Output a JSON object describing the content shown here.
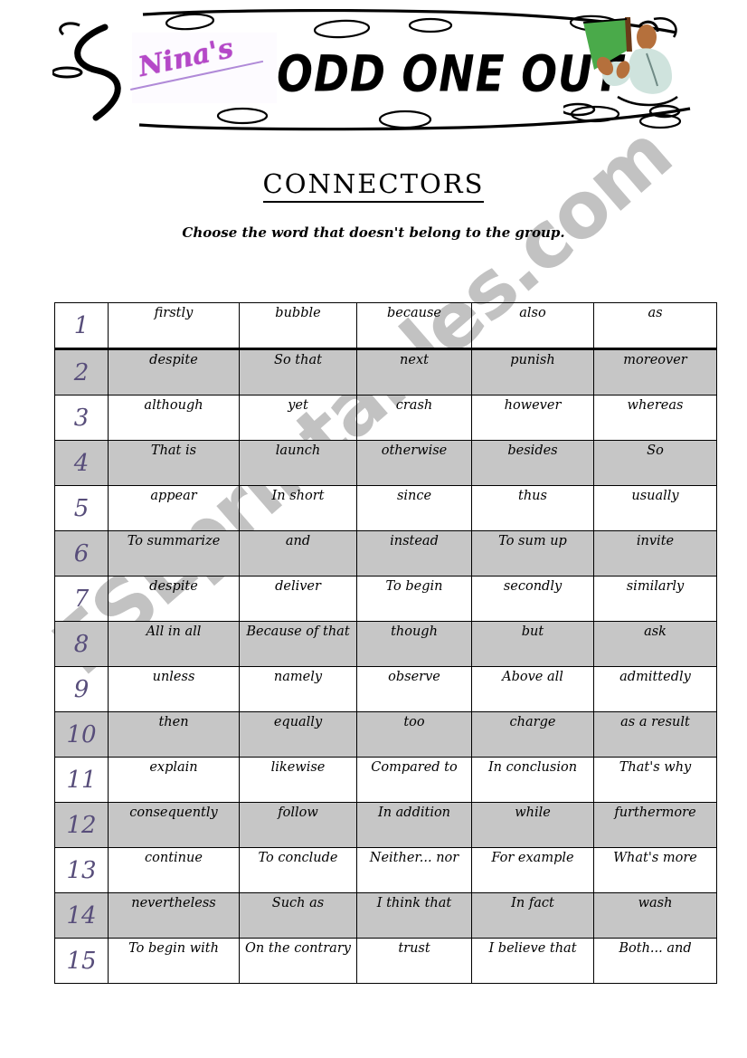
{
  "banner": {
    "brand_label": "Nina's",
    "worksheet_type": "ODD ONE OUT",
    "clipart_name": "person-reading-book-clipart"
  },
  "title": "CONNECTORS",
  "instruction": "Choose the word that doesn't belong to the group.",
  "watermark": "ESLprintables.com",
  "colors": {
    "number_purple": "#574d7a",
    "brand_purple": "#b548c8",
    "row_shade_gray": "#c6c6c6",
    "watermark_gray": "#c2c2c2",
    "page_background": "#ffffff",
    "border_black": "#000000"
  },
  "table": {
    "rows": [
      {
        "n": "1",
        "shaded": false,
        "cells": [
          "firstly",
          "bubble",
          "because",
          "also",
          "as"
        ]
      },
      {
        "n": "2",
        "shaded": true,
        "cells": [
          "despite",
          "So that",
          "next",
          "punish",
          "moreover"
        ]
      },
      {
        "n": "3",
        "shaded": false,
        "cells": [
          "although",
          "yet",
          "crash",
          "however",
          "whereas"
        ]
      },
      {
        "n": "4",
        "shaded": true,
        "cells": [
          "That is",
          "launch",
          "otherwise",
          "besides",
          "So"
        ]
      },
      {
        "n": "5",
        "shaded": false,
        "cells": [
          "appear",
          "In short",
          "since",
          "thus",
          "usually"
        ]
      },
      {
        "n": "6",
        "shaded": true,
        "cells": [
          "To summarize",
          "and",
          "instead",
          "To sum up",
          "invite"
        ]
      },
      {
        "n": "7",
        "shaded": false,
        "cells": [
          "despite",
          "deliver",
          "To begin",
          "secondly",
          "similarly"
        ]
      },
      {
        "n": "8",
        "shaded": true,
        "cells": [
          "All in all",
          "Because of that",
          "though",
          "but",
          "ask"
        ]
      },
      {
        "n": "9",
        "shaded": false,
        "cells": [
          "unless",
          "namely",
          "observe",
          "Above all",
          "admittedly"
        ]
      },
      {
        "n": "10",
        "shaded": true,
        "cells": [
          "then",
          "equally",
          "too",
          "charge",
          "as a result"
        ]
      },
      {
        "n": "11",
        "shaded": false,
        "cells": [
          "explain",
          "likewise",
          "Compared to",
          "In conclusion",
          "That's why"
        ]
      },
      {
        "n": "12",
        "shaded": true,
        "cells": [
          "consequently",
          "follow",
          "In addition",
          "while",
          "furthermore"
        ]
      },
      {
        "n": "13",
        "shaded": false,
        "cells": [
          "continue",
          "To conclude",
          "Neither... nor",
          "For example",
          "What's more"
        ]
      },
      {
        "n": "14",
        "shaded": true,
        "cells": [
          "nevertheless",
          "Such as",
          "I think that",
          "In fact",
          "wash"
        ]
      },
      {
        "n": "15",
        "shaded": false,
        "cells": [
          "To begin with",
          "On the contrary",
          "trust",
          "I believe that",
          "Both... and"
        ]
      }
    ]
  }
}
